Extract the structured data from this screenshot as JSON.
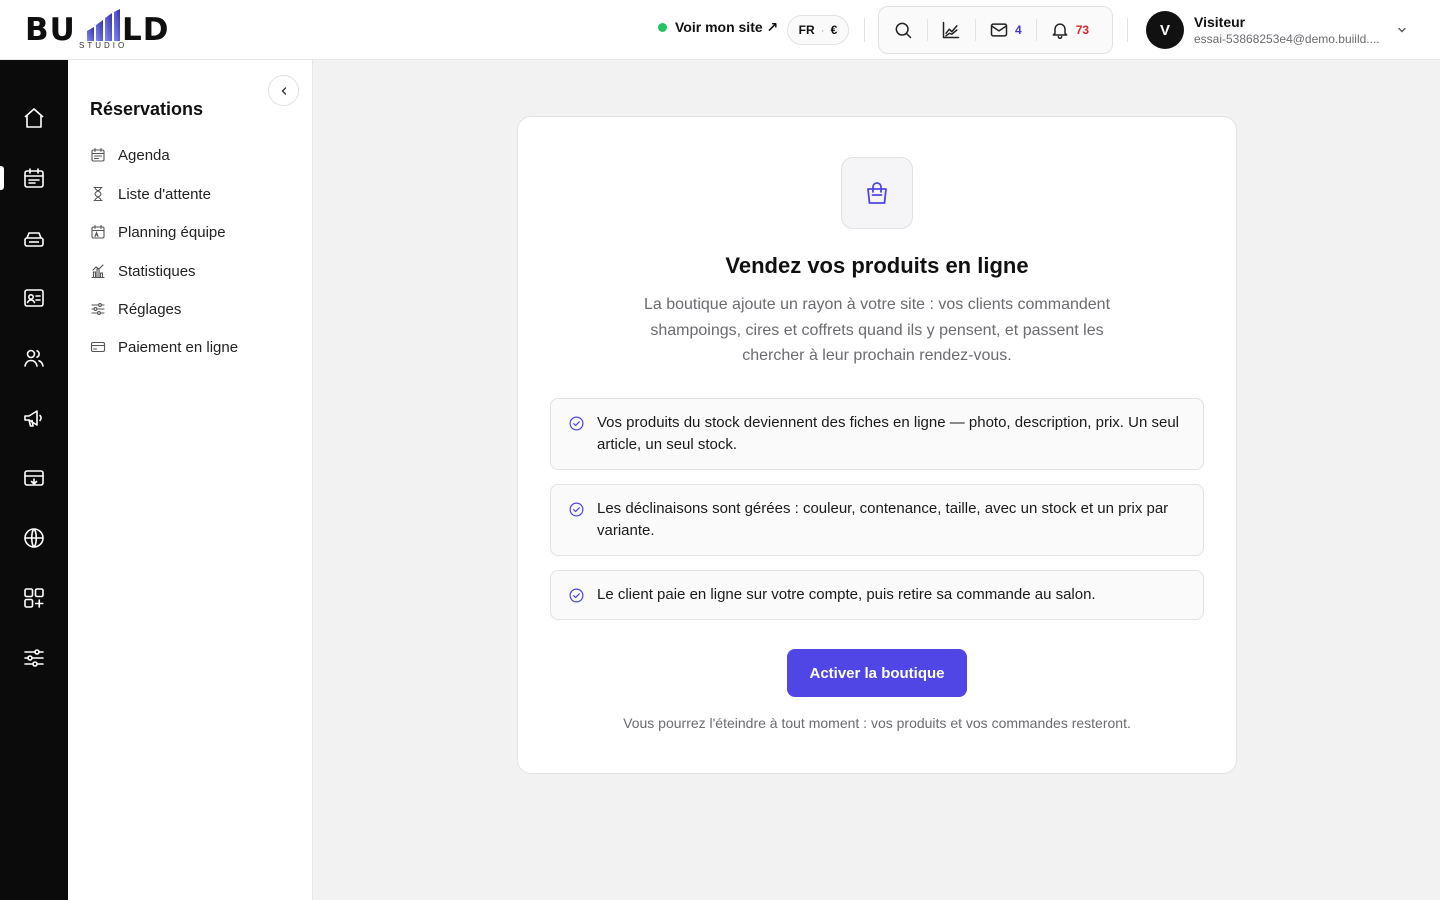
{
  "brand": {
    "logo_text_left": "BU",
    "logo_text_right": "LD",
    "logo_sub": "STUDIO",
    "accent": "#4f46e5"
  },
  "header": {
    "site_link": "Voir mon site ↗",
    "lang": "FR",
    "lang_sep": "·",
    "currency": "€",
    "messages_count": "4",
    "notifications_count": "73",
    "user_initial": "V",
    "user_name": "Visiteur",
    "user_email": "essai-53868253e4@demo.buiild...."
  },
  "rail": {
    "items": [
      {
        "icon": "home-icon"
      },
      {
        "icon": "calendar-icon",
        "active": true
      },
      {
        "icon": "register-icon"
      },
      {
        "icon": "contact-card-icon"
      },
      {
        "icon": "users-icon"
      },
      {
        "icon": "megaphone-icon"
      },
      {
        "icon": "payment-terminal-icon"
      },
      {
        "icon": "globe-icon"
      },
      {
        "icon": "apps-icon"
      },
      {
        "icon": "settings-sliders-icon"
      }
    ]
  },
  "submenu": {
    "title": "Réservations",
    "items": [
      {
        "label": "Agenda",
        "icon": "calendar-icon"
      },
      {
        "label": "Liste d'attente",
        "icon": "hourglass-icon"
      },
      {
        "label": "Planning équipe",
        "icon": "team-calendar-icon"
      },
      {
        "label": "Statistiques",
        "icon": "stats-icon"
      },
      {
        "label": "Réglages",
        "icon": "sliders-icon"
      },
      {
        "label": "Paiement en ligne",
        "icon": "credit-card-icon"
      }
    ]
  },
  "main": {
    "icon": "shopping-bag-icon",
    "title": "Vendez vos produits en ligne",
    "description": "La boutique ajoute un rayon à votre site : vos clients commandent shampoings, cires et coffrets quand ils y pensent, et passent les chercher à leur prochain rendez-vous.",
    "features": [
      "Vos produits du stock deviennent des fiches en ligne — photo, description, prix. Un seul article, un seul stock.",
      "Les déclinaisons sont gérées : couleur, contenance, taille, avec un stock et un prix par variante.",
      "Le client paie en ligne sur votre compte, puis retire sa commande au salon."
    ],
    "cta_label": "Activer la boutique",
    "footnote": "Vous pourrez l'éteindre à tout moment : vos produits et vos commandes resteront."
  }
}
